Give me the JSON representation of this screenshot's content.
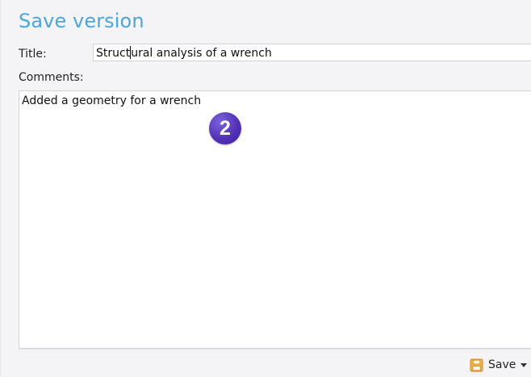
{
  "dialog": {
    "heading": "Save version"
  },
  "form": {
    "title_label": "Title:",
    "title_value_before_caret": "Struct",
    "title_value_after_caret": "ural analysis of a wrench",
    "comments_label": "Comments:",
    "comments_value": "Added a geometry for a wrench"
  },
  "callout": {
    "step_number": "2",
    "color": "#5332b9"
  },
  "footer": {
    "save_label": "Save",
    "save_icon": "floppy-disk-icon",
    "dropdown_icon": "chevron-down-icon"
  },
  "colors": {
    "heading": "#4ea5d9",
    "save_icon": "#f0a030"
  }
}
